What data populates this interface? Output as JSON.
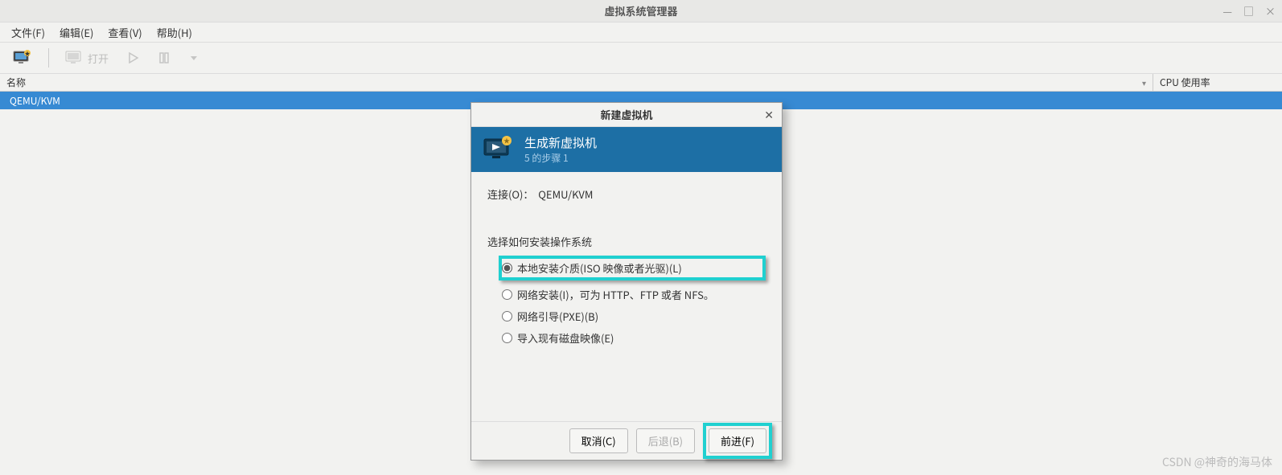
{
  "window": {
    "title": "虚拟系统管理器"
  },
  "menu": {
    "file": "文件(F)",
    "edit": "编辑(E)",
    "view": "查看(V)",
    "help": "帮助(H)"
  },
  "toolbar": {
    "open": "打开"
  },
  "columns": {
    "name": "名称",
    "cpu": "CPU 使用率"
  },
  "list": {
    "rows": [
      "QEMU/KVM"
    ]
  },
  "dialog": {
    "title": "新建虚拟机",
    "header_title": "生成新虚拟机",
    "header_sub": "5 的步骤 1",
    "conn_label": "连接(O)：",
    "conn_value": "QEMU/KVM",
    "section_label": "选择如何安装操作系统",
    "options": {
      "local": "本地安装介质(ISO 映像或者光驱)(L)",
      "network": "网络安装(I)，可为 HTTP、FTP 或者 NFS。",
      "pxe": "网络引导(PXE)(B)",
      "import": "导入现有磁盘映像(E)"
    },
    "buttons": {
      "cancel": "取消(C)",
      "back": "后退(B)",
      "forward": "前进(F)"
    }
  },
  "watermark": "CSDN @神奇的海马体"
}
